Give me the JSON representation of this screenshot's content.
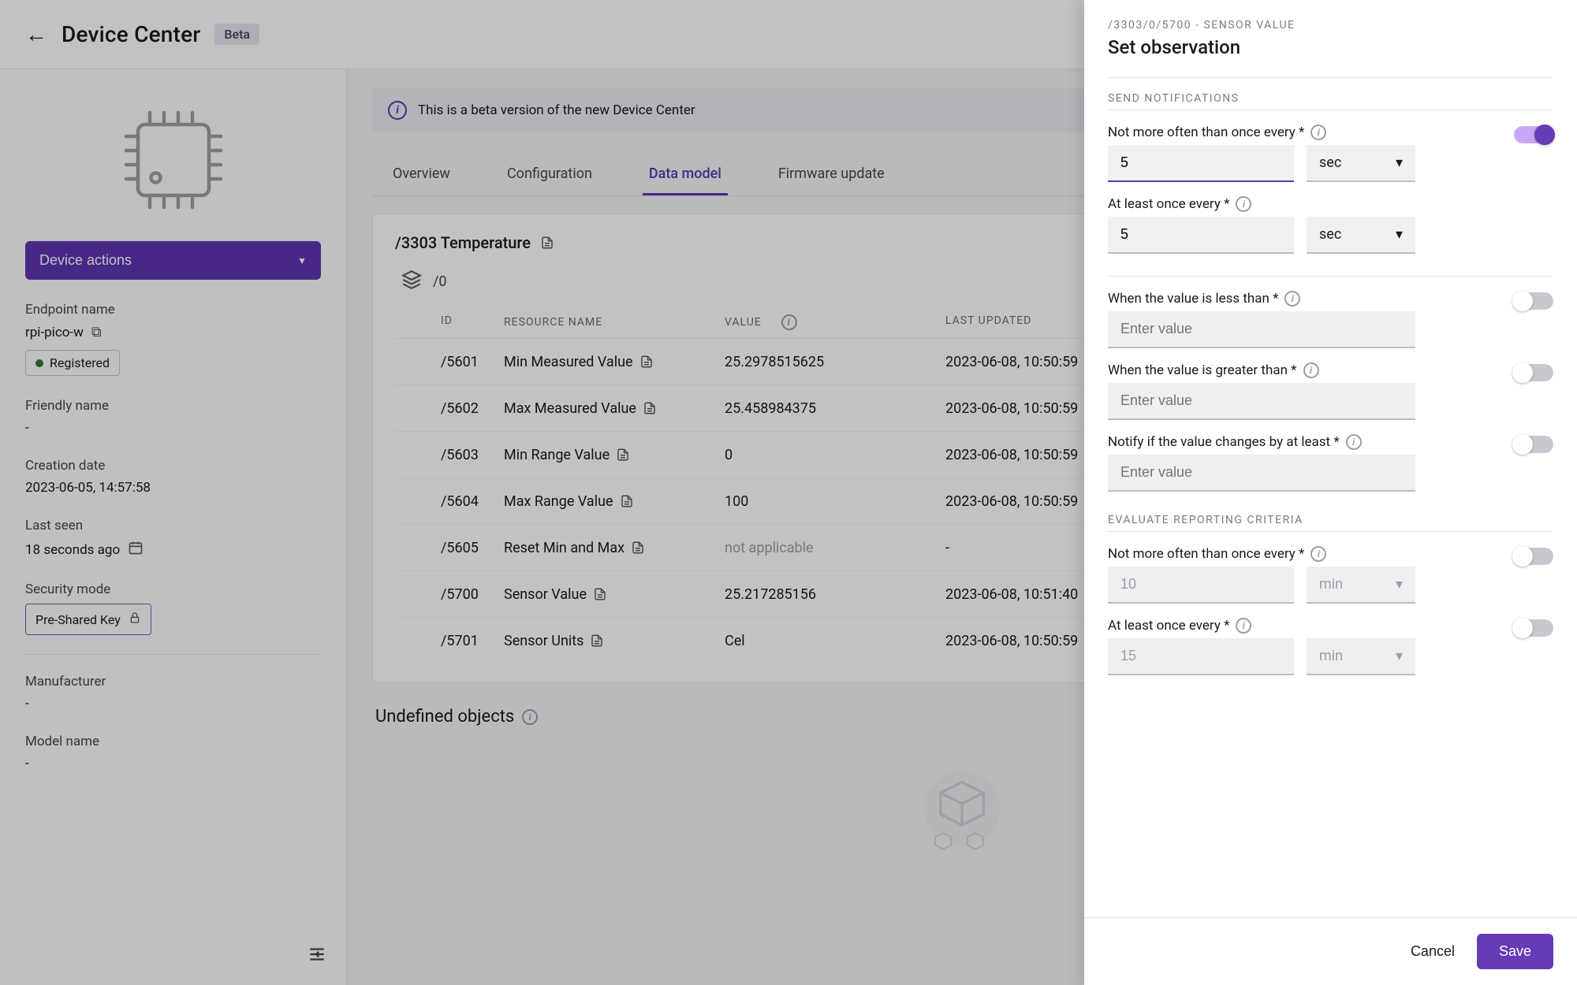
{
  "header": {
    "title": "Device Center",
    "beta_tag": "Beta"
  },
  "sidebar": {
    "device_actions_label": "Device actions",
    "endpoint_name_label": "Endpoint name",
    "endpoint_name_value": "rpi-pico-w",
    "status_label": "Registered",
    "friendly_name_label": "Friendly name",
    "friendly_name_value": "-",
    "creation_date_label": "Creation date",
    "creation_date_value": "2023-06-05, 14:57:58",
    "last_seen_label": "Last seen",
    "last_seen_value": "18 seconds ago",
    "security_mode_label": "Security mode",
    "security_mode_value": "Pre-Shared Key",
    "manufacturer_label": "Manufacturer",
    "manufacturer_value": "-",
    "model_name_label": "Model name",
    "model_name_value": "-"
  },
  "content": {
    "banner_text": "This is a beta version of the new Device Center",
    "tabs": [
      "Overview",
      "Configuration",
      "Data model",
      "Firmware update"
    ],
    "active_tab_index": 2,
    "object_title": "/3303 Temperature",
    "instance_label": "/0",
    "columns": [
      "ID",
      "RESOURCE NAME",
      "VALUE",
      "LAST UPDATED"
    ],
    "rows": [
      {
        "id": "/5601",
        "name": "Min Measured Value",
        "value": "25.2978515625",
        "updated": "2023-06-08, 10:50:59"
      },
      {
        "id": "/5602",
        "name": "Max Measured Value",
        "value": "25.458984375",
        "updated": "2023-06-08, 10:50:59"
      },
      {
        "id": "/5603",
        "name": "Min Range Value",
        "value": "0",
        "updated": "2023-06-08, 10:50:59"
      },
      {
        "id": "/5604",
        "name": "Max Range Value",
        "value": "100",
        "updated": "2023-06-08, 10:50:59"
      },
      {
        "id": "/5605",
        "name": "Reset Min and Max",
        "value": "not applicable",
        "updated": "-",
        "na": true
      },
      {
        "id": "/5700",
        "name": "Sensor Value",
        "value": "25.217285156",
        "updated": "2023-06-08, 10:51:40"
      },
      {
        "id": "/5701",
        "name": "Sensor Units",
        "value": "Cel",
        "updated": "2023-06-08, 10:50:59"
      }
    ],
    "undefined_title": "Undefined objects"
  },
  "drawer": {
    "crumb": "/3303/0/5700 - SENSOR VALUE",
    "title": "Set observation",
    "send_section": "SEND NOTIFICATIONS",
    "not_more_label": "Not more often than once every *",
    "not_more_value": "5",
    "not_more_unit": "sec",
    "at_least_label": "At least once every *",
    "at_least_value": "5",
    "at_least_unit": "sec",
    "less_than_label": "When the value is less than *",
    "greater_than_label": "When the value is greater than *",
    "step_label": "Notify if the value changes by at least *",
    "enter_value_ph": "Enter value",
    "eval_section": "EVALUATE REPORTING CRITERIA",
    "eval_not_more_value": "10",
    "eval_not_more_unit": "min",
    "eval_at_least_value": "15",
    "eval_at_least_unit": "min",
    "cancel_label": "Cancel",
    "save_label": "Save"
  }
}
